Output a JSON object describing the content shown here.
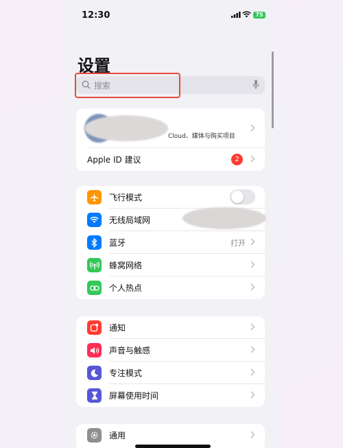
{
  "status": {
    "time": "12:30",
    "battery": "75"
  },
  "header": {
    "title": "设置"
  },
  "search": {
    "placeholder": "搜索"
  },
  "account": {
    "subtitle_visible": "Cloud、媒体与购买项目",
    "apple_id_suggestions": "Apple ID 建议",
    "badge_count": "2"
  },
  "connectivity": [
    {
      "label": "飞行模式",
      "icon": "airplane-icon",
      "color": "#ff9500",
      "control": "toggle",
      "on": false
    },
    {
      "label": "无线局域网",
      "icon": "wifi-icon",
      "color": "#007aff",
      "control": "chevron"
    },
    {
      "label": "蓝牙",
      "icon": "bluetooth-icon",
      "color": "#007aff",
      "value": "打开",
      "control": "chevron"
    },
    {
      "label": "蜂窝网络",
      "icon": "cellular-icon",
      "color": "#34c759",
      "control": "chevron"
    },
    {
      "label": "个人热点",
      "icon": "hotspot-icon",
      "color": "#34c759",
      "control": "chevron"
    }
  ],
  "notifications": [
    {
      "label": "通知",
      "icon": "bell-icon",
      "color": "#ff3b30"
    },
    {
      "label": "声音与触感",
      "icon": "speaker-icon",
      "color": "#ff2d55"
    },
    {
      "label": "专注模式",
      "icon": "moon-icon",
      "color": "#5856d6"
    },
    {
      "label": "屏幕使用时间",
      "icon": "hourglass-icon",
      "color": "#5856d6"
    }
  ],
  "general": [
    {
      "label": "通用",
      "icon": "gear-icon",
      "color": "#8e8e93"
    }
  ]
}
